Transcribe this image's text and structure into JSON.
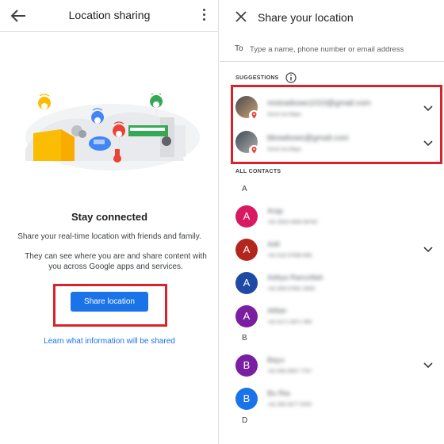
{
  "left": {
    "title": "Location sharing",
    "heading": "Stay connected",
    "description1": "Share your real-time location with friends and family.",
    "description2": "They can see where you are and share content with you across Google apps and services.",
    "share_button": "Share location",
    "learn_link": "Learn what information will be shared"
  },
  "right": {
    "title": "Share your location",
    "to_label": "To",
    "to_placeholder": "Type a name, phone number or email address",
    "suggestions_label": "SUGGESTIONS",
    "all_contacts_label": "ALL CONTACTS",
    "suggestions": [
      {
        "name": "restowbows1010@gmail.com",
        "sub": "Send via Maps"
      },
      {
        "name": "bbowbows@gmail.com",
        "sub": "Send via Maps"
      }
    ],
    "sections": [
      {
        "letter": "A",
        "contacts": [
          {
            "initial": "A",
            "color": "#d81b60",
            "name": "Arap",
            "sub": "+62 0828 4856 98760",
            "expand": false
          },
          {
            "initial": "A",
            "color": "#b3261e",
            "name": "Adil",
            "sub": "+62 818 67698 668",
            "expand": true
          },
          {
            "initial": "A",
            "color": "#1e4aa5",
            "name": "Aditya Ramzillah",
            "sub": "+62 858 87691 0808",
            "expand": false
          },
          {
            "initial": "A",
            "color": "#7b1fa2",
            "name": "Afifah",
            "sub": "+62 8171 8871 999",
            "expand": false
          }
        ]
      },
      {
        "letter": "B",
        "contacts": [
          {
            "initial": "B",
            "color": "#7b1fa2",
            "name": "Bayu",
            "sub": "+62 856 8567 7767",
            "expand": true
          },
          {
            "initial": "B",
            "color": "#1a73e8",
            "name": "Bu Ria",
            "sub": "+62 856 8577 9090",
            "expand": false
          }
        ]
      },
      {
        "letter": "D",
        "contacts": []
      }
    ]
  },
  "colors": {
    "accent": "#1a73e8",
    "highlight": "#d9232a"
  }
}
